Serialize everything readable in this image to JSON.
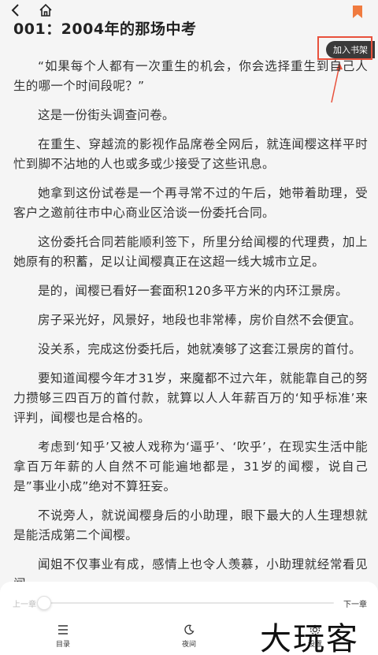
{
  "header": {
    "chapter_title": "001：2004年的那场中考",
    "back_icon": "chevron-left-icon",
    "home_icon": "home-icon",
    "bookmark_icon": "bookmark-icon"
  },
  "add_to_shelf": "加入书架",
  "paragraphs": [
    "“如果每个人都有一次重生的机会，你会选择重生到自己人生的哪一个时间段呢？”",
    "这是一份街头调查问卷。",
    "在重生、穿越流的影视作品席卷全网后，就连闻樱这样平时忙到脚不沾地的人也或多或少接受了这些讯息。",
    "她拿到这份试卷是一个再寻常不过的午后，她带着助理，受客户之邀前往市中心商业区洽谈一份委托合同。",
    "这份委托合同若能顺利签下，所里分给闻樱的代理费，加上她原有的积蓄，足以让闻樱真正在这超一线大城市立足。",
    "是的，闻樱已看好一套面积120多平方米的内环江景房。",
    "房子采光好，风景好，地段也非常棒，房价自然不会便宜。",
    "没关系，完成这份委托后，她就凑够了这套江景房的首付。",
    "要知道闻樱今年才31岁，来魔都不过六年，就能靠自己的努力攒够三四百万的首付款，就算以人人年薪百万的‘知乎标准’来评判，闻樱也是合格的。",
    "考虑到‘知乎’又被人戏称为‘逼乎’、‘吹乎’，在现实生活中能拿百万年薪的人自然不可能遍地都是，31岁的闻樱，说自己是”事业小成”绝对不算狂妄。",
    "不说旁人，就说闻樱身后的小助理，眼下最大的人生理想就是能活成第二个闻樱。",
    "闻姐不仅事业有成，感情上也令人羡慕，小助理就经常看见闻"
  ],
  "bottom": {
    "prev_chapter": "上一章",
    "next_chapter": "下一章",
    "progress": 0.0,
    "tab_toc": "目录",
    "tab_night": "夜间",
    "tab_settings": "设置"
  },
  "watermark": "大玩客",
  "colors": {
    "bookmark": "#f07b3f",
    "highlight": "#e8513c",
    "background": "#f5f5f5"
  }
}
